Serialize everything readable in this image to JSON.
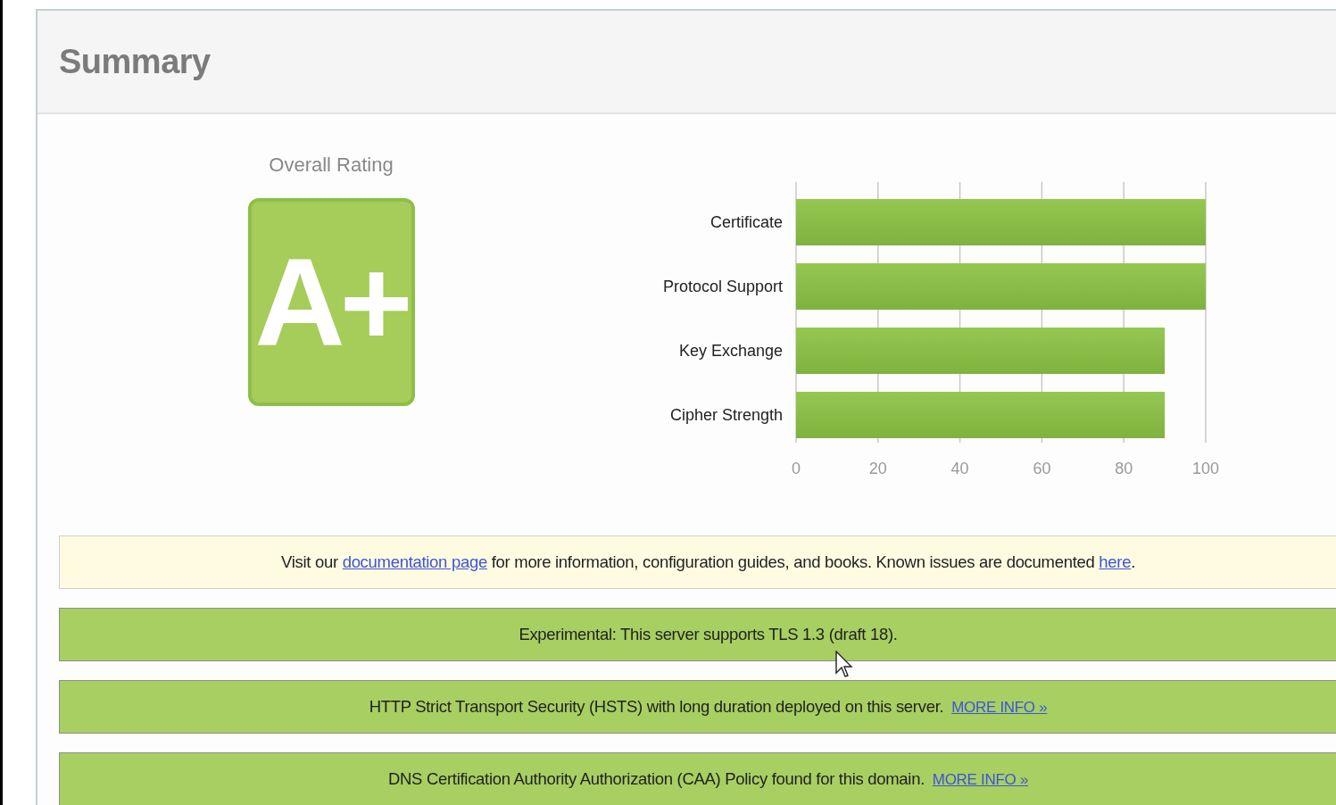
{
  "panel": {
    "title": "Summary"
  },
  "rating": {
    "label": "Overall Rating",
    "grade": "A+"
  },
  "chart_data": {
    "type": "bar",
    "orientation": "horizontal",
    "categories": [
      "Certificate",
      "Protocol Support",
      "Key Exchange",
      "Cipher Strength"
    ],
    "series": [
      {
        "color": "#7fb23e",
        "values": [
          100,
          100,
          90,
          90
        ]
      }
    ],
    "xlim": [
      0,
      100
    ],
    "xticks": [
      0,
      20,
      40,
      60,
      80,
      100
    ],
    "grid": true
  },
  "notices": [
    {
      "kind": "info",
      "parts": [
        {
          "text": "Visit our "
        },
        {
          "link": "documentation page"
        },
        {
          "text": " for more information, configuration guides, and books. Known issues are documented "
        },
        {
          "link": "here"
        },
        {
          "text": "."
        }
      ]
    },
    {
      "kind": "success",
      "parts": [
        {
          "text": "Experimental: This server supports TLS 1.3 (draft 18)."
        }
      ]
    },
    {
      "kind": "success",
      "parts": [
        {
          "text": "HTTP Strict Transport Security (HSTS) with long duration deployed on this server.  "
        },
        {
          "link": "MORE INFO »"
        }
      ]
    },
    {
      "kind": "success",
      "parts": [
        {
          "text": "DNS Certification Authority Authorization (CAA) Policy found for this domain.  "
        },
        {
          "link": "MORE INFO »"
        }
      ]
    }
  ]
}
